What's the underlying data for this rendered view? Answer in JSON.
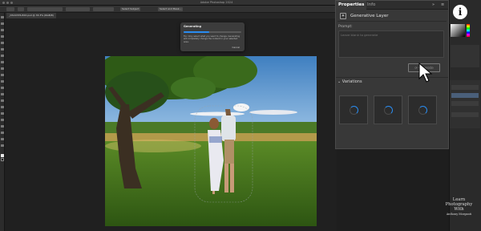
{
  "app": {
    "title": "Adobe Photoshop 2024"
  },
  "options_bar": {
    "buttons": [
      "Select Subject",
      "Select and Mask..."
    ]
  },
  "document_tab": {
    "label": "_DSC0376-Edit.psd @ 33.3% (RGB/8)"
  },
  "generating_dialog": {
    "title": "Generating",
    "progress": 0.45,
    "tip": "Tip: Only select what you want to change. Generating will completely change the content in your selected area.",
    "cancel_label": "Cancel"
  },
  "properties_panel": {
    "tabs": [
      "Properties",
      "Info"
    ],
    "layer_type": "Generative Layer",
    "prompt_label": "Prompt:",
    "prompt_placeholder": "Leave blank to generate",
    "generate_label": "Generate",
    "variations_label": "Variations",
    "variation_count": 3
  },
  "watermark": {
    "line1": "Learn",
    "line2": "Photography",
    "line3": "With",
    "line4": "Anthony Morganti"
  },
  "colors": {
    "accent": "#2a8cf0",
    "panel_bg": "#383838",
    "app_bg": "#1e1e1e"
  },
  "icons": [
    "info-icon",
    "generative-layer-icon",
    "generate-icon",
    "chevron-down-icon",
    "pointer-cursor-icon"
  ]
}
